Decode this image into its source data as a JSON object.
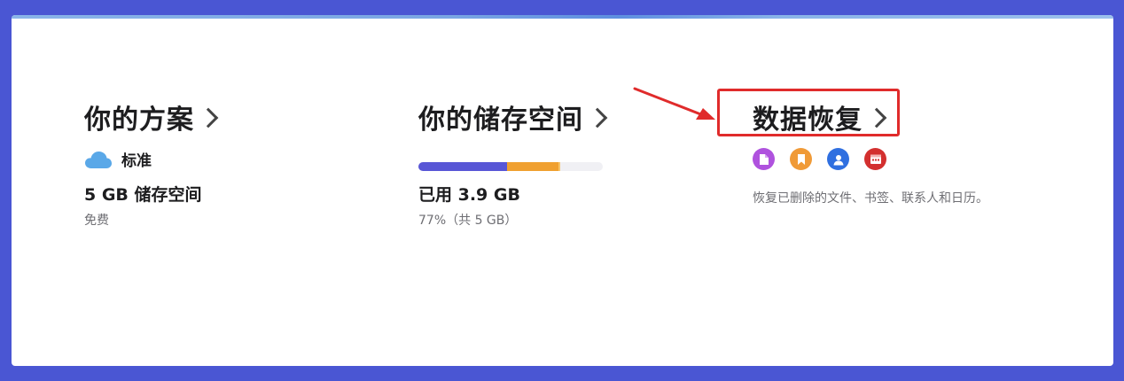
{
  "plan": {
    "title": "你的方案",
    "name": "标准",
    "storage": "5 GB 储存空间",
    "price": "免费"
  },
  "storage": {
    "title": "你的储存空间",
    "used": "已用 3.9 GB",
    "percent": "77%（共 5 GB）",
    "segments": [
      {
        "name": "segment-1",
        "fraction": 0.48,
        "color": "#5856d6"
      },
      {
        "name": "segment-2",
        "fraction": 0.28,
        "color": "#f0a030"
      },
      {
        "name": "segment-3",
        "fraction": 0.01,
        "color": "#f7c46a"
      }
    ]
  },
  "recovery": {
    "title": "数据恢复",
    "description": "恢复已删除的文件、书签、联系人和日历。",
    "icons": [
      {
        "name": "files-icon",
        "color": "#af52de"
      },
      {
        "name": "bookmarks-icon",
        "color": "#f09a37"
      },
      {
        "name": "contacts-icon",
        "color": "#2f6fe0"
      },
      {
        "name": "calendar-icon",
        "color": "#d3302f"
      }
    ]
  },
  "colors": {
    "background": "#4a56d3",
    "highlight": "#e02b2b",
    "cloud": "#5aa8e8"
  }
}
